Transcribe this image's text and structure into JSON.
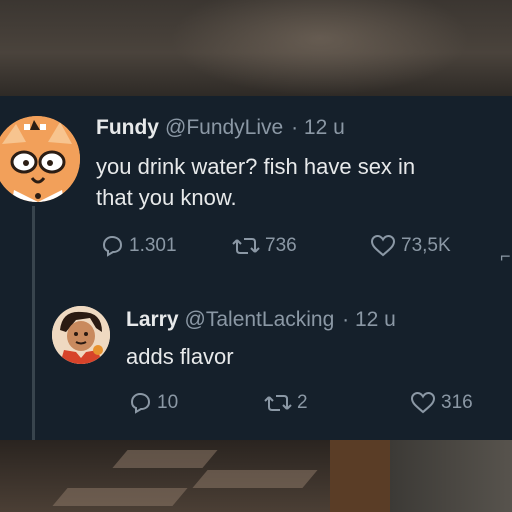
{
  "tweet": {
    "author_name": "Fundy",
    "author_handle": "@FundyLive",
    "time": "· 12 u",
    "text_line1": "you drink water? fish have sex in",
    "text_line2": "that you know.",
    "replies": "1.301",
    "retweets": "736",
    "likes": "73,5K"
  },
  "reply": {
    "author_name": "Larry",
    "author_handle": "@TalentLacking",
    "time": "· 12 u",
    "text": "adds flavor",
    "replies": "10",
    "retweets": "2",
    "likes": "316"
  },
  "icons": {
    "reply": "reply-icon",
    "retweet": "retweet-icon",
    "like": "heart-icon"
  },
  "colors": {
    "card_background": "#15202b",
    "primary_text": "#e7e9ea",
    "secondary_text": "#8b98a5",
    "thread_line": "#38444d"
  }
}
